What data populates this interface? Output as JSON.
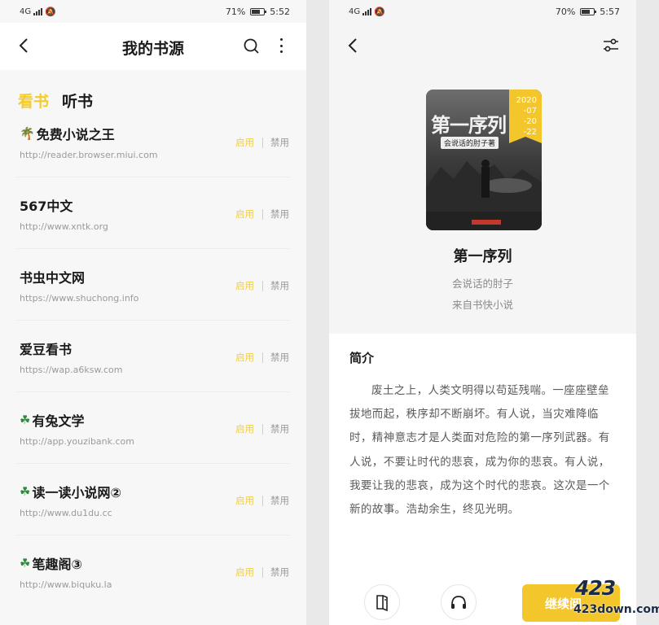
{
  "left_screen": {
    "status": {
      "network": "4G",
      "battery": "71%",
      "battery_level": 0.71,
      "time": "5:52"
    },
    "header": {
      "title": "我的书源"
    },
    "tabs": [
      {
        "label": "看书",
        "active": true
      },
      {
        "label": "听书",
        "active": false
      }
    ],
    "sources": [
      {
        "prefix": "🌴",
        "name": "免费小说之王",
        "url": "http://reader.browser.miui.com",
        "enable": "启用",
        "disable": "禁用"
      },
      {
        "prefix": "",
        "name": "567中文",
        "url": "http://www.xntk.org",
        "enable": "启用",
        "disable": "禁用"
      },
      {
        "prefix": "",
        "name": "书虫中文网",
        "url": "https://www.shuchong.info",
        "enable": "启用",
        "disable": "禁用"
      },
      {
        "prefix": "",
        "name": "爱豆看书",
        "url": "https://wap.a6ksw.com",
        "enable": "启用",
        "disable": "禁用"
      },
      {
        "prefix": "☘",
        "name": "有兔文学",
        "url": "http://app.youzibank.com",
        "enable": "启用",
        "disable": "禁用"
      },
      {
        "prefix": "☘",
        "name": "读一读小说网②",
        "url": "http://www.du1du.cc",
        "enable": "启用",
        "disable": "禁用"
      },
      {
        "prefix": "☘",
        "name": "笔趣阁③",
        "url": "http://www.biquku.la",
        "enable": "启用",
        "disable": "禁用"
      }
    ]
  },
  "right_screen": {
    "status": {
      "network": "4G",
      "battery": "70%",
      "battery_level": 0.7,
      "time": "5:57"
    },
    "book": {
      "cover_title": "第一序列",
      "cover_author": "会说话的肘子著",
      "cover_date": [
        "2020",
        "-07",
        "-20",
        "-22"
      ],
      "title": "第一序列",
      "author": "会说话的肘子",
      "source": "来自书快小说"
    },
    "intro": {
      "heading": "简介",
      "text": "废土之上，人类文明得以苟延残喘。一座座壁垒拔地而起，秩序却不断崩坏。有人说，当灾难降临时，精神意志才是人类面对危险的第一序列武器。有人说，不要让时代的悲哀，成为你的悲哀。有人说，我要让我的悲哀，成为这个时代的悲哀。这次是一个新的故事。浩劫余生，终见光明。"
    },
    "bottom": {
      "continue_label": "继续阅"
    }
  },
  "watermark": {
    "big": "423",
    "small": "423down.com"
  },
  "colors": {
    "accent": "#f3c62c",
    "enable_text": "#f0cf4c"
  }
}
